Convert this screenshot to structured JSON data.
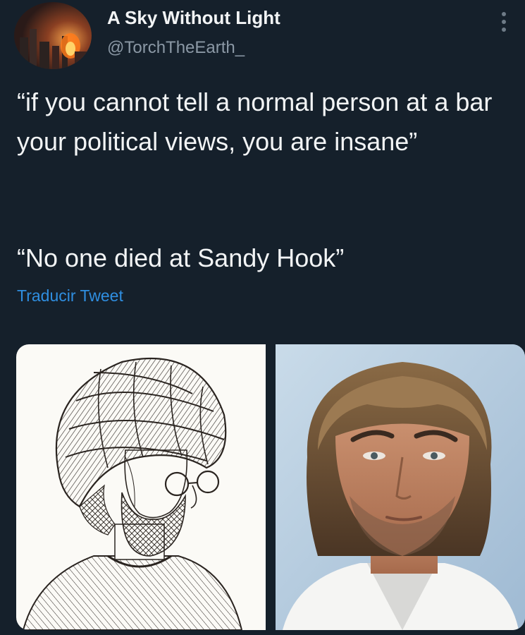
{
  "tweet": {
    "author": {
      "display_name": "A Sky Without Light",
      "handle": "@TorchTheEarth_",
      "avatar_icon": "burning-city-avatar"
    },
    "menu_icon": "more-vertical-icon",
    "paragraphs": [
      "“if you cannot tell a normal person at a bar your political views, you are insane”",
      "“No one died at Sandy Hook”"
    ],
    "translate_link": "Traducir Tweet",
    "colors": {
      "background": "#15202b",
      "text": "#f2f4f5",
      "secondary_text": "#8b98a5",
      "link": "#2f8ee0"
    }
  },
  "media": {
    "left_image": "engraved-bearded-man-in-turban-illustration",
    "right_image": "man-with-long-hair-and-stubble-photo"
  }
}
